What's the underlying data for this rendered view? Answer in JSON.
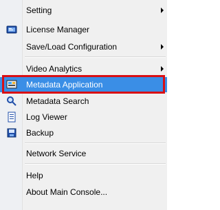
{
  "menu": {
    "items": [
      {
        "label": "Setting",
        "has_submenu": true,
        "icon": ""
      },
      {
        "label": "License Manager",
        "has_submenu": false,
        "icon": "license-icon"
      },
      {
        "label": "Save/Load Configuration",
        "has_submenu": true,
        "icon": ""
      },
      {
        "label": "Video Analytics",
        "has_submenu": true,
        "icon": ""
      },
      {
        "label": "Metadata Application",
        "has_submenu": false,
        "icon": "metadata-application-icon",
        "highlighted": true
      },
      {
        "label": "Metadata Search",
        "has_submenu": false,
        "icon": "metadata-search-icon"
      },
      {
        "label": "Log Viewer",
        "has_submenu": false,
        "icon": "log-viewer-icon"
      },
      {
        "label": "Backup",
        "has_submenu": false,
        "icon": "backup-icon"
      },
      {
        "label": "Network Service",
        "has_submenu": false,
        "icon": ""
      },
      {
        "label": "Help",
        "has_submenu": false,
        "icon": ""
      },
      {
        "label": "About Main Console...",
        "has_submenu": false,
        "icon": ""
      }
    ]
  },
  "colors": {
    "highlight": "#3a8ee6",
    "outline": "#d90f14",
    "menu_background": "#f0f0f0"
  }
}
